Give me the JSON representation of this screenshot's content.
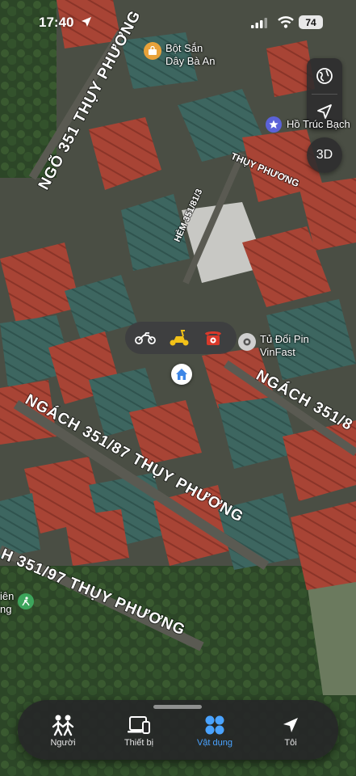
{
  "status_bar": {
    "time": "17:40",
    "battery": "74"
  },
  "map": {
    "roads": [
      {
        "name": "NGÕ 351 THỤY PHƯƠNG"
      },
      {
        "name": "THỤY PHƯƠNG"
      },
      {
        "name": "HẺM 351/81/3"
      },
      {
        "name": "NGÁCH 351/8"
      },
      {
        "name": "NGÁCH 351/87 THỤY PHƯƠNG"
      },
      {
        "name": "H 351/97 THỤY PHƯƠNG"
      }
    ],
    "pois": [
      {
        "name": "Bột Sắn\nDây Bà An"
      },
      {
        "name": "Hồ Trúc Bạch"
      },
      {
        "name": "Tủ Đổi Pin\nVinFast"
      },
      {
        "name": "iên\nng"
      }
    ]
  },
  "controls": {
    "three_d": "3D"
  },
  "tabs": [
    {
      "label": "Người",
      "icon": "people-icon"
    },
    {
      "label": "Thiết bị",
      "icon": "devices-icon"
    },
    {
      "label": "Vật dụng",
      "icon": "items-icon",
      "active": true
    },
    {
      "label": "Tôi",
      "icon": "location-arrow-icon"
    }
  ],
  "colors": {
    "active_tab": "#4aa3ff",
    "roof_red": "#b04a38",
    "roof_teal": "#3f6a62",
    "vegetation": "#2f4a2a"
  }
}
